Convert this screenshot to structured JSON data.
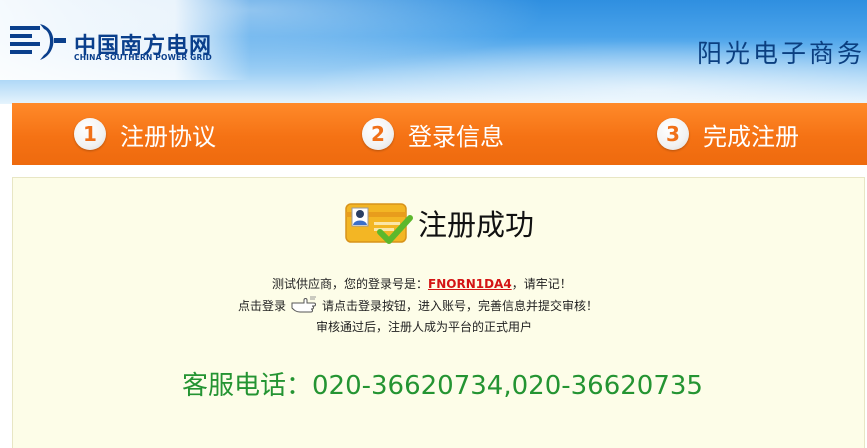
{
  "header": {
    "logo_cn": "中国南方电网",
    "logo_en": "CHINA SOUTHERN POWER GRID",
    "site_title": "阳光电子商务"
  },
  "steps": [
    {
      "num": "1",
      "label": "注册协议"
    },
    {
      "num": "2",
      "label": "登录信息"
    },
    {
      "num": "3",
      "label": "完成注册"
    }
  ],
  "result": {
    "title": "注册成功",
    "line1_prefix": "测试供应商，您的登录号是：",
    "login_code": "FNORN1DA4",
    "line1_suffix": "，请牢记！",
    "line2_prefix": "点击登录",
    "line2_suffix": "请点击登录按钮，进入账号，完善信息并提交审核！",
    "line3": "审核通过后，注册人成为平台的正式用户",
    "phone": "客服电话：020-36620734,020-36620735"
  },
  "colors": {
    "header_blue": "#2f8fe0",
    "step_orange": "#f57214",
    "panel_bg": "#fdfde8",
    "code_red": "#d41414",
    "phone_green": "#249432"
  },
  "icons": {
    "logo": "csg-logo-icon",
    "success": "id-card-check-icon",
    "login": "pointing-hand-icon"
  }
}
